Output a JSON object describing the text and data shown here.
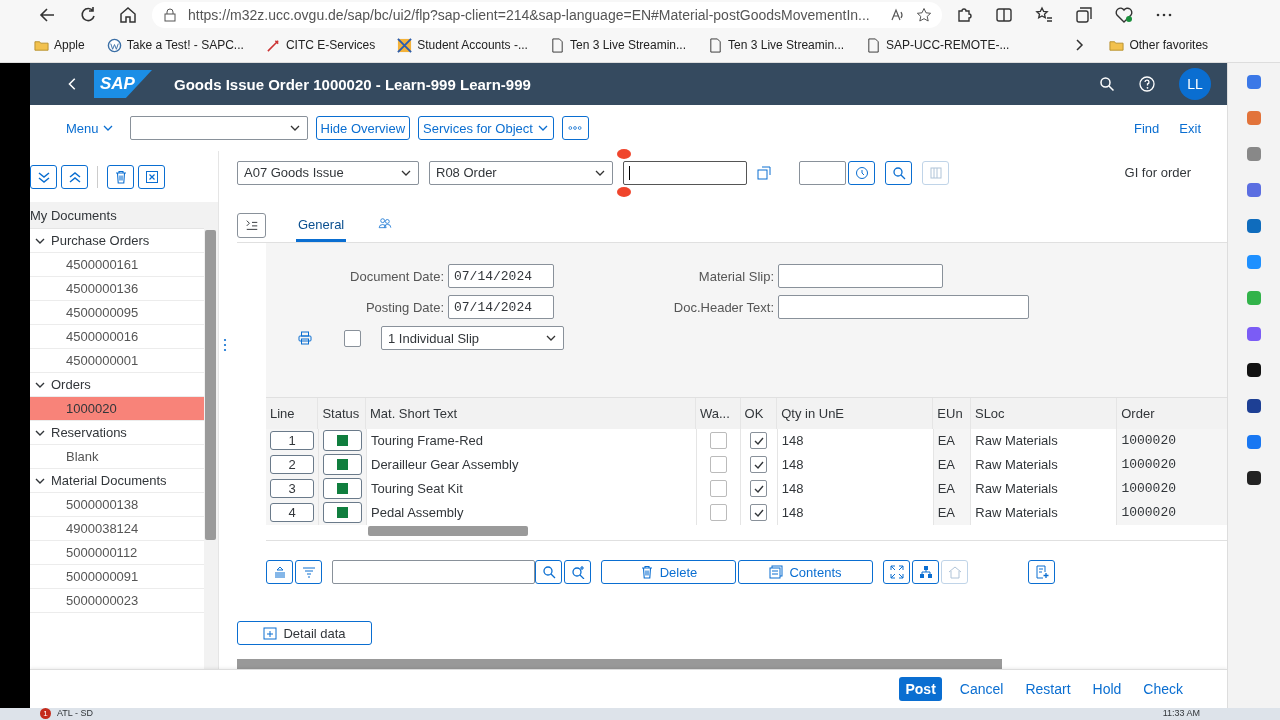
{
  "browser": {
    "url": "https://m32z.ucc.ovgu.de/sap/bc/ui2/flp?sap-client=214&sap-language=EN#Material-postGoodsMovementIn...",
    "bookmarks": [
      {
        "label": "Apple",
        "kind": "folder"
      },
      {
        "label": "Take a Test! - SAPC...",
        "kind": "wp"
      },
      {
        "label": "CITC E-Services",
        "kind": "pen"
      },
      {
        "label": "Student Accounts -...",
        "kind": "site"
      },
      {
        "label": "Ten 3 Live Streamin...",
        "kind": "page"
      },
      {
        "label": "Ten 3 Live Streamin...",
        "kind": "page"
      },
      {
        "label": "SAP-UCC-REMOTE-...",
        "kind": "page"
      }
    ],
    "other_favorites": "Other favorites"
  },
  "shell": {
    "logo": "SAP",
    "title": "Goods Issue Order 1000020 - Learn-999 Learn-999",
    "avatar": "LL"
  },
  "menu_bar": {
    "menu": "Menu",
    "buttons": [
      "Hide Overview",
      "Services for Object"
    ],
    "actions": [
      "Find",
      "Exit"
    ]
  },
  "selectors": {
    "transaction": "A07 Goods Issue",
    "reference": "R08 Order",
    "gi_text": "GI for order"
  },
  "sidebar": {
    "title": "My Documents",
    "groups": [
      {
        "label": "Purchase Orders",
        "expanded": true,
        "children": [
          {
            "label": "4500000161",
            "selected": false
          },
          {
            "label": "4500000136",
            "selected": false
          },
          {
            "label": "4500000095",
            "selected": false
          },
          {
            "label": "4500000016",
            "selected": false
          },
          {
            "label": "4500000001",
            "selected": false
          }
        ]
      },
      {
        "label": "Orders",
        "expanded": true,
        "children": [
          {
            "label": "1000020",
            "selected": true
          }
        ]
      },
      {
        "label": "Reservations",
        "expanded": true,
        "children": [
          {
            "label": "Blank",
            "selected": false
          }
        ]
      },
      {
        "label": "Material Documents",
        "expanded": true,
        "children": [
          {
            "label": "5000000138",
            "selected": false
          },
          {
            "label": "4900038124",
            "selected": false
          },
          {
            "label": "5000000112",
            "selected": false
          },
          {
            "label": "5000000091",
            "selected": false
          },
          {
            "label": "5000000023",
            "selected": false
          }
        ]
      }
    ]
  },
  "tabs": [
    {
      "kind": "text",
      "label": "General",
      "selected": true
    },
    {
      "kind": "icon",
      "selected": false
    }
  ],
  "form": {
    "left": [
      {
        "label": "Document Date:",
        "value": "07/14/2024"
      },
      {
        "label": "Posting Date:",
        "value": "07/14/2024"
      }
    ],
    "right": [
      {
        "label": "Material Slip:"
      },
      {
        "label": "Doc.Header Text:"
      }
    ],
    "print_checked": false,
    "slip": "1 Individual Slip"
  },
  "table": {
    "columns": [
      "Line",
      "Status",
      "Mat. Short Text",
      "Wa...",
      "OK",
      "Qty in UnE",
      "EUn",
      "SLoc",
      "Order"
    ],
    "rows": [
      {
        "line": "1",
        "color": "#107e3e",
        "text": "Touring Frame-Red",
        "withdrawn": false,
        "ok": true,
        "qty": "148",
        "unit": "EA",
        "sloc": "Raw Materials",
        "order": "1000020"
      },
      {
        "line": "2",
        "color": "#107e3e",
        "text": "Derailleur Gear Assembly",
        "withdrawn": false,
        "ok": true,
        "qty": "148",
        "unit": "EA",
        "sloc": "Raw Materials",
        "order": "1000020"
      },
      {
        "line": "3",
        "color": "#107e3e",
        "text": "Touring Seat Kit",
        "withdrawn": false,
        "ok": true,
        "qty": "148",
        "unit": "EA",
        "sloc": "Raw Materials",
        "order": "1000020"
      },
      {
        "line": "4",
        "color": "#107e3e",
        "text": "Pedal Assembly",
        "withdrawn": false,
        "ok": true,
        "qty": "148",
        "unit": "EA",
        "sloc": "Raw Materials",
        "order": "1000020"
      }
    ]
  },
  "table_buttons": [
    "Delete",
    "Contents"
  ],
  "detail_button": "Detail data",
  "footer": [
    {
      "label": "Post",
      "kind": "primary"
    },
    {
      "label": "Cancel",
      "kind": "link"
    },
    {
      "label": "Restart",
      "kind": "link"
    },
    {
      "label": "Hold",
      "kind": "link"
    },
    {
      "label": "Check",
      "kind": "link"
    }
  ],
  "taskbar": {
    "badge": "1",
    "label": "ATL - SD",
    "time": "11:33 AM"
  }
}
